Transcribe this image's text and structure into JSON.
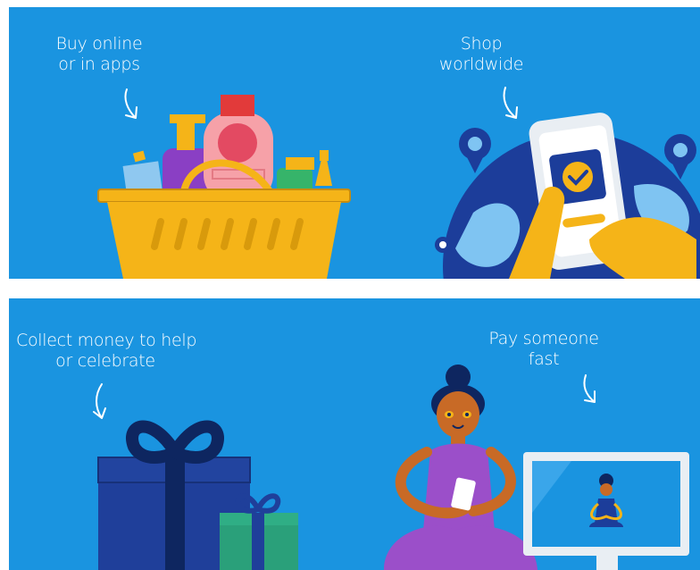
{
  "panels": [
    {
      "id": "top",
      "captions": [
        {
          "lines": [
            "Buy online",
            "or in apps"
          ]
        },
        {
          "lines": [
            "Shop",
            "worldwide"
          ]
        }
      ]
    },
    {
      "id": "bottom",
      "captions": [
        {
          "lines": [
            "Collect money to help",
            "or celebrate"
          ]
        },
        {
          "lines": [
            "Pay someone",
            "fast"
          ]
        }
      ]
    }
  ],
  "colors": {
    "background": "#1a94e0",
    "basket": "#f5b418",
    "phone": "#e9eef3",
    "gift_large": "#1f3f9a",
    "gift_small": "#2aa07a",
    "person_shirt": "#9b4fc9"
  }
}
